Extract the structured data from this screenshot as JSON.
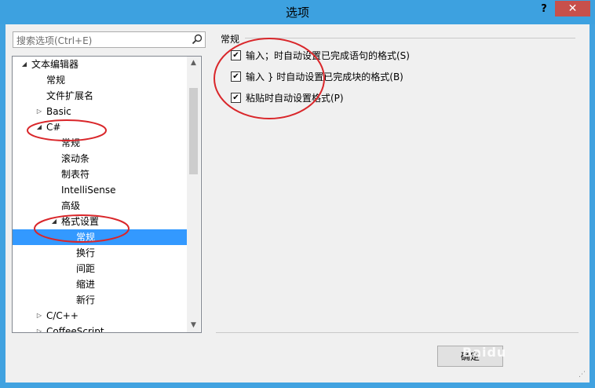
{
  "window": {
    "title": "选项",
    "help_label": "?",
    "close_label": "✕"
  },
  "search": {
    "placeholder": "搜索选项(Ctrl+E)"
  },
  "tree": {
    "items": [
      {
        "label": "文本编辑器",
        "arrow": "◢",
        "level": 0
      },
      {
        "label": "常规",
        "arrow": "",
        "level": 1
      },
      {
        "label": "文件扩展名",
        "arrow": "",
        "level": 1
      },
      {
        "label": "Basic",
        "arrow": "▷",
        "level": 1
      },
      {
        "label": "C#",
        "arrow": "◢",
        "level": 1
      },
      {
        "label": "常规",
        "arrow": "",
        "level": 2
      },
      {
        "label": "滚动条",
        "arrow": "",
        "level": 2
      },
      {
        "label": "制表符",
        "arrow": "",
        "level": 2
      },
      {
        "label": "IntelliSense",
        "arrow": "",
        "level": 2
      },
      {
        "label": "高级",
        "arrow": "",
        "level": 2
      },
      {
        "label": "格式设置",
        "arrow": "◢",
        "level": 2
      },
      {
        "label": "常规",
        "arrow": "",
        "level": 3,
        "selected": true
      },
      {
        "label": "换行",
        "arrow": "",
        "level": 3
      },
      {
        "label": "间距",
        "arrow": "",
        "level": 3
      },
      {
        "label": "缩进",
        "arrow": "",
        "level": 3
      },
      {
        "label": "新行",
        "arrow": "",
        "level": 3
      },
      {
        "label": "C/C++",
        "arrow": "▷",
        "level": 1
      },
      {
        "label": "CoffeeScript",
        "arrow": "▷",
        "level": 1
      }
    ],
    "scroll_up": "▲",
    "scroll_down": "▼"
  },
  "panel": {
    "group_label": "常规",
    "options": [
      {
        "label": "输入；时自动设置已完成语句的格式(S)",
        "checked": true
      },
      {
        "label": "输入 } 时自动设置已完成块的格式(B)",
        "checked": true
      },
      {
        "label": "粘贴时自动设置格式(P)",
        "checked": true
      }
    ],
    "check_mark": "✔"
  },
  "footer": {
    "ok_label": "确定"
  },
  "watermark": "Baidu",
  "colors": {
    "title_bar": "#3da1e0",
    "close": "#c7504b",
    "selection": "#3399ff",
    "annotation": "#d9262a"
  }
}
